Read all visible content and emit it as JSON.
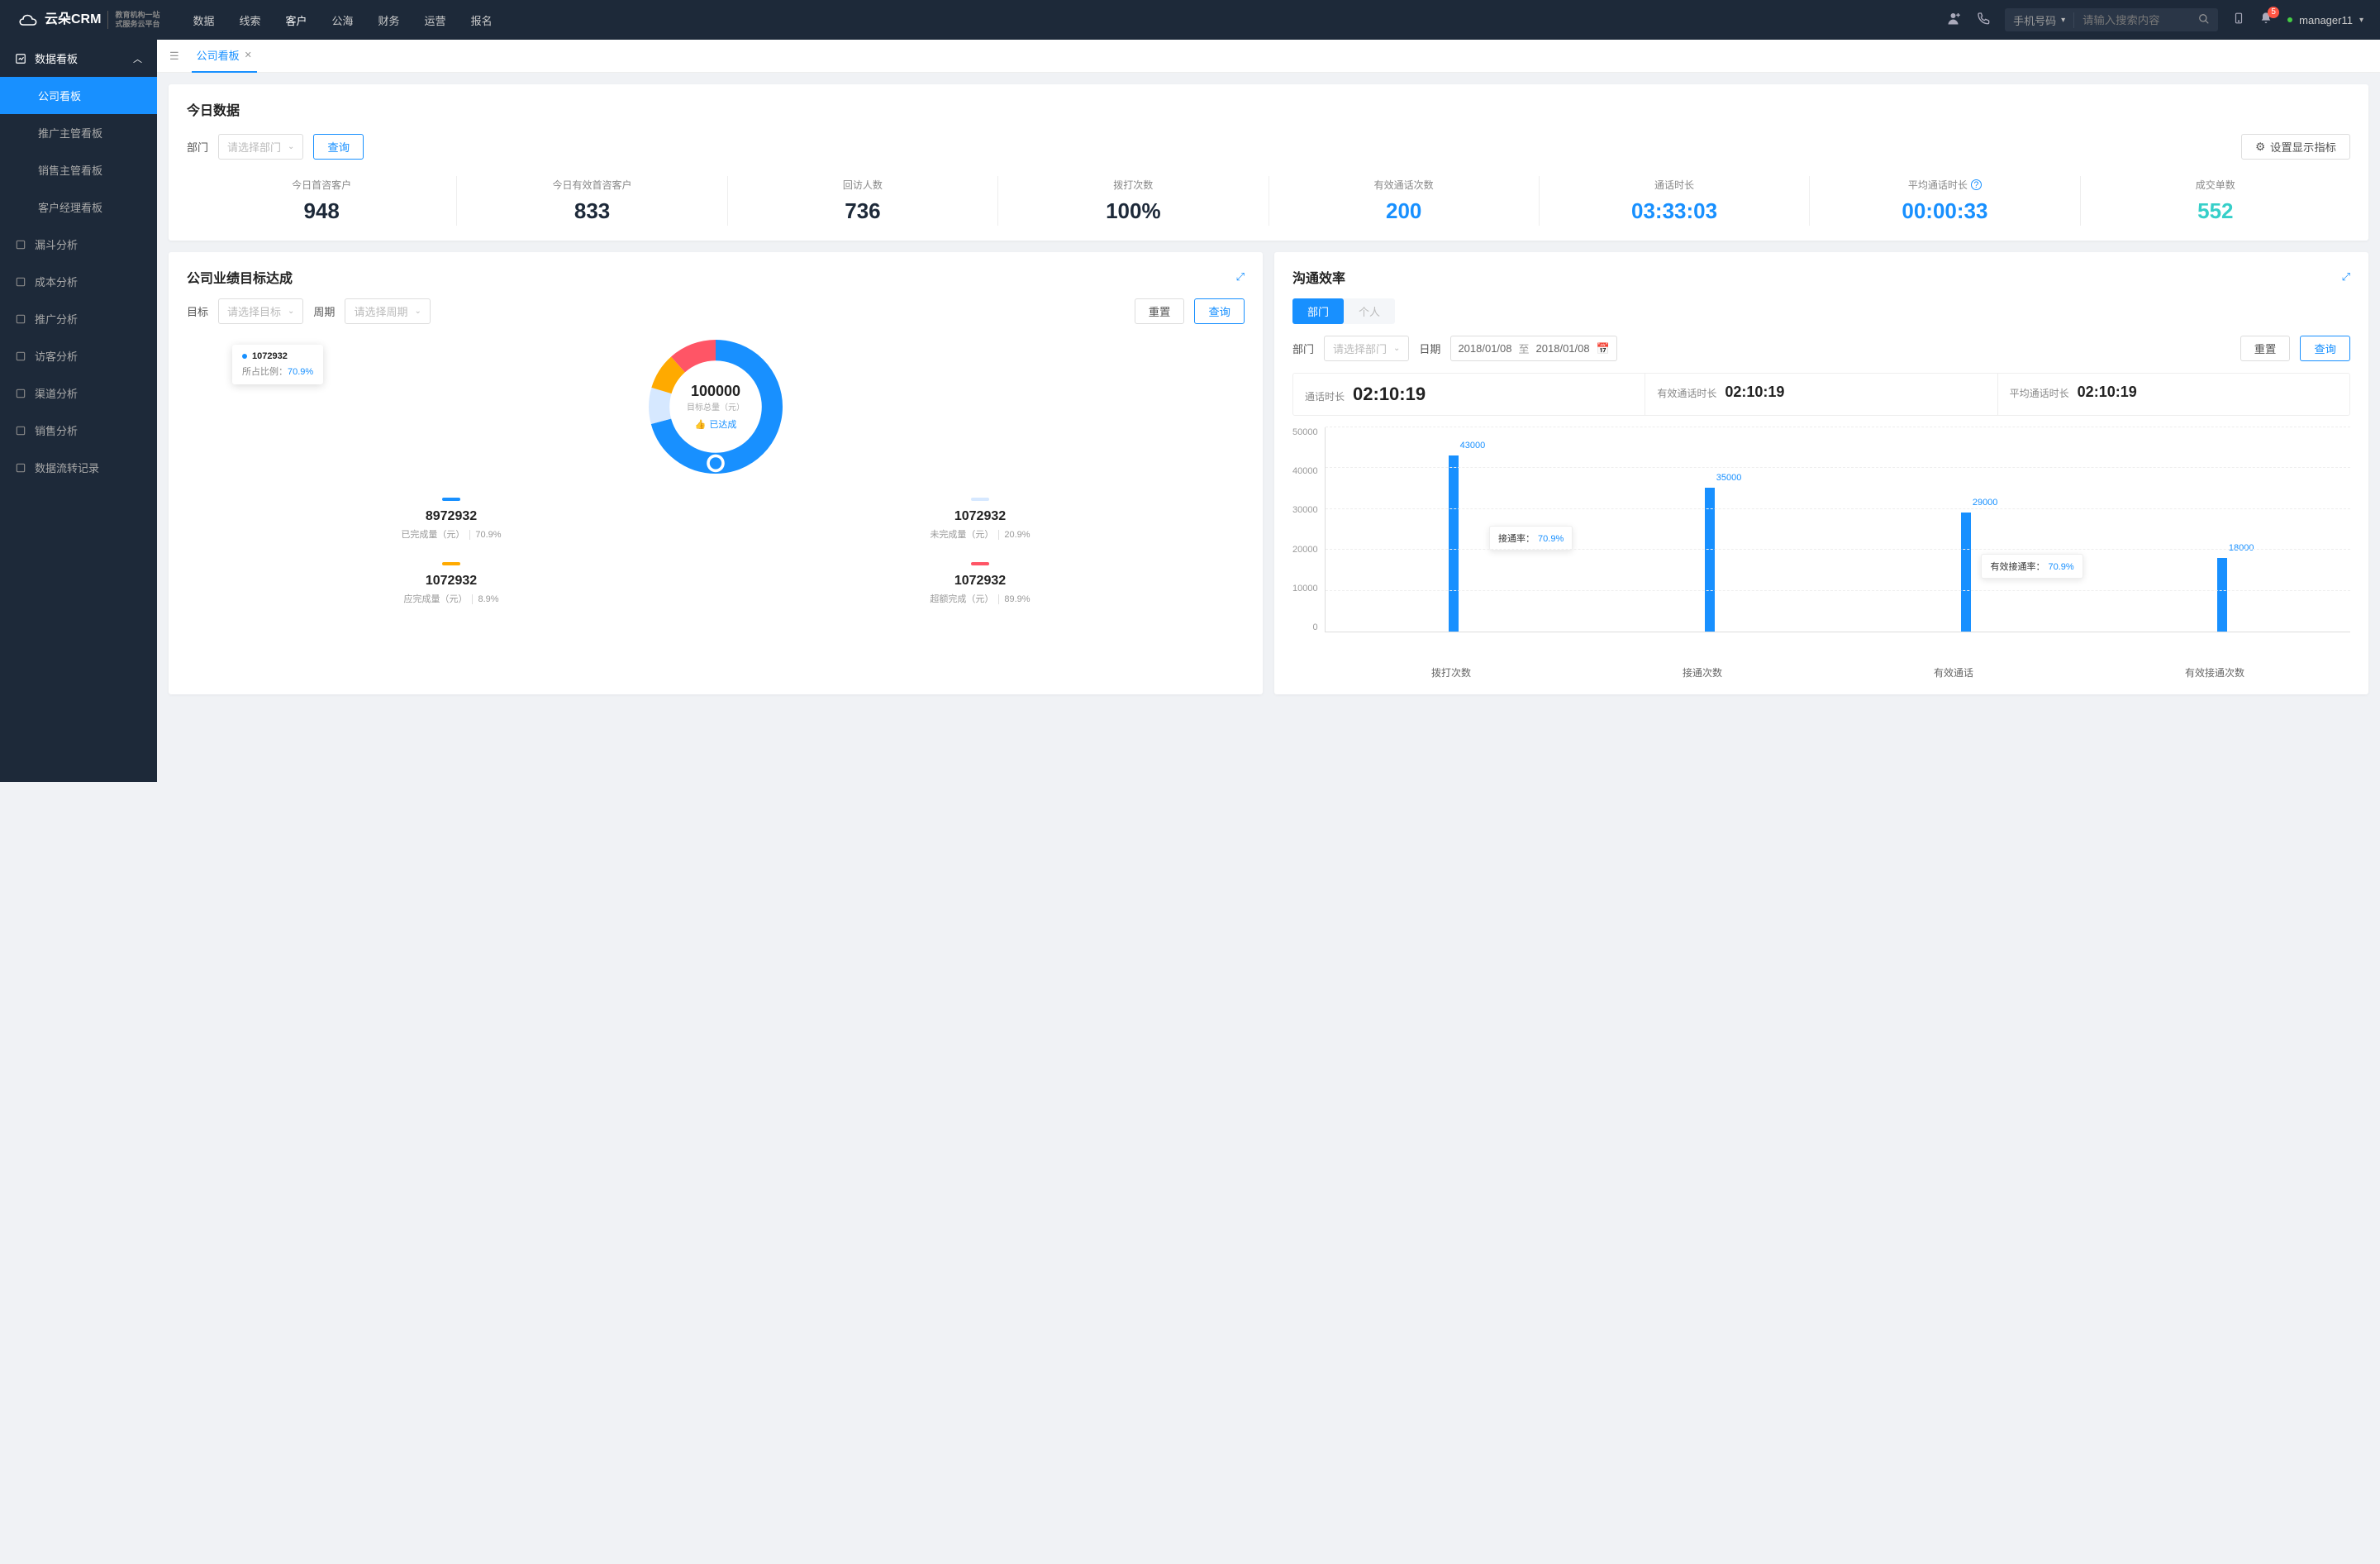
{
  "header": {
    "logo": "云朵CRM",
    "logo_sub1": "教育机构一站",
    "logo_sub2": "式服务云平台",
    "nav": [
      "数据",
      "线索",
      "客户",
      "公海",
      "财务",
      "运营",
      "报名"
    ],
    "nav_active": 2,
    "search_select": "手机号码",
    "search_placeholder": "请输入搜索内容",
    "notif_count": "5",
    "user": "manager11"
  },
  "sidebar": {
    "group": "数据看板",
    "items": [
      "公司看板",
      "推广主管看板",
      "销售主管看板",
      "客户经理看板"
    ],
    "active": 0,
    "others": [
      "漏斗分析",
      "成本分析",
      "推广分析",
      "访客分析",
      "渠道分析",
      "销售分析",
      "数据流转记录"
    ]
  },
  "tabs": {
    "tab": "公司看板"
  },
  "today": {
    "title": "今日数据",
    "dept_label": "部门",
    "dept_placeholder": "请选择部门",
    "query": "查询",
    "settings": "设置显示指标",
    "stats": [
      {
        "label": "今日首咨客户",
        "value": "948",
        "cls": "c-dark"
      },
      {
        "label": "今日有效首咨客户",
        "value": "833",
        "cls": "c-dark"
      },
      {
        "label": "回访人数",
        "value": "736",
        "cls": "c-dark"
      },
      {
        "label": "拨打次数",
        "value": "100%",
        "cls": "c-dark"
      },
      {
        "label": "有效通话次数",
        "value": "200",
        "cls": "c-blue"
      },
      {
        "label": "通话时长",
        "value": "03:33:03",
        "cls": "c-blue"
      },
      {
        "label": "平均通话时长",
        "value": "00:00:33",
        "cls": "c-blue",
        "info": true
      },
      {
        "label": "成交单数",
        "value": "552",
        "cls": "c-cyan"
      }
    ]
  },
  "target": {
    "title": "公司业绩目标达成",
    "target_label": "目标",
    "target_placeholder": "请选择目标",
    "period_label": "周期",
    "period_placeholder": "请选择周期",
    "reset": "重置",
    "query": "查询",
    "center_value": "100000",
    "center_sub": "目标总量（元）",
    "status": "已达成",
    "tooltip_value": "1072932",
    "tooltip_label": "所占比例：",
    "tooltip_pct": "70.9%",
    "legend": [
      {
        "color": "#1890ff",
        "value": "8972932",
        "label": "已完成量（元）",
        "pct": "70.9%"
      },
      {
        "color": "#d6e8ff",
        "value": "1072932",
        "label": "未完成量（元）",
        "pct": "20.9%"
      },
      {
        "color": "#fa0",
        "value": "1072932",
        "label": "应完成量（元）",
        "pct": "8.9%"
      },
      {
        "color": "#f56",
        "value": "1072932",
        "label": "超额完成（元）",
        "pct": "89.9%"
      }
    ]
  },
  "comm": {
    "title": "沟通效率",
    "seg": [
      "部门",
      "个人"
    ],
    "dept_label": "部门",
    "dept_placeholder": "请选择部门",
    "date_label": "日期",
    "date_from": "2018/01/08",
    "date_to_label": "至",
    "date_to": "2018/01/08",
    "reset": "重置",
    "query": "查询",
    "summary": [
      {
        "label": "通话时长",
        "value": "02:10:19"
      },
      {
        "label": "有效通话时长",
        "value": "02:10:19"
      },
      {
        "label": "平均通话时长",
        "value": "02:10:19"
      }
    ],
    "callout1": {
      "label": "接通率：",
      "pct": "70.9%"
    },
    "callout2": {
      "label": "有效接通率：",
      "pct": "70.9%"
    }
  },
  "chart_data": {
    "type": "bar",
    "categories": [
      "拨打次数",
      "接通次数",
      "有效通话",
      "有效接通次数"
    ],
    "values": [
      43000,
      35000,
      29000,
      18000
    ],
    "ylim": [
      0,
      50000
    ],
    "yticks": [
      0,
      10000,
      20000,
      30000,
      40000,
      50000
    ]
  }
}
